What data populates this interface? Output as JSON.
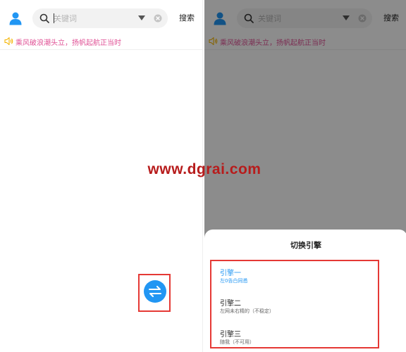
{
  "colors": {
    "accent": "#2196f3",
    "notice": "#e05296",
    "highlight": "#e53935",
    "watermark": "#b71c1c"
  },
  "topbar": {
    "avatar_icon": "person-icon",
    "search_placeholder": "关键词",
    "search_label": "搜索"
  },
  "notice": {
    "text": "乘风破浪潮头立，扬帆起航正当时"
  },
  "switch_button": {
    "icon": "swap-arrows-icon"
  },
  "sheet": {
    "title": "切换引擎",
    "engines": [
      {
        "name": "引擎一",
        "desc": "左0告白同悉"
      },
      {
        "name": "引擎二",
        "desc": "左网未右精的（不稳定）"
      },
      {
        "name": "引擎三",
        "desc": "随我（不可用）"
      }
    ]
  },
  "watermark": "www.dgrai.com"
}
